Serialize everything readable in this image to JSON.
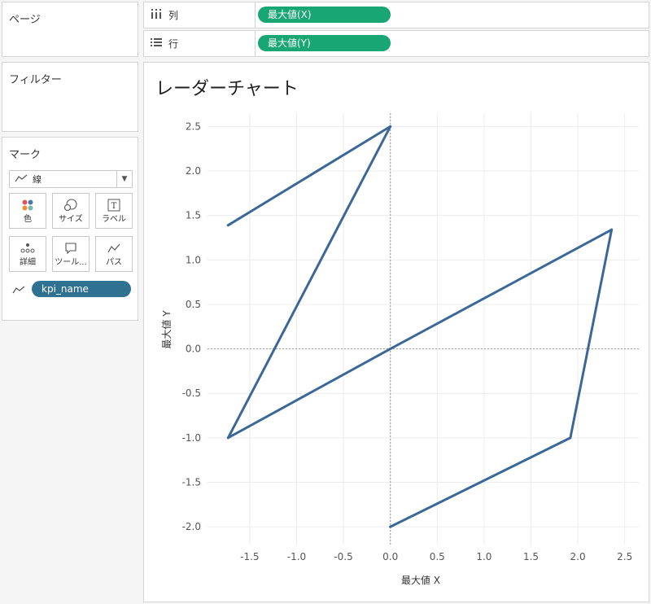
{
  "pages_panel": {
    "title": "ページ"
  },
  "filters_panel": {
    "title": "フィルター"
  },
  "marks_panel": {
    "title": "マーク",
    "mark_type": "線",
    "buttons": [
      "色",
      "サイズ",
      "ラベル",
      "詳細",
      "ツール...",
      "パス"
    ],
    "field_pill": "kpi_name"
  },
  "columns_shelf": {
    "label": "列",
    "pill": "最大値(X)"
  },
  "rows_shelf": {
    "label": "行",
    "pill": "最大値(Y)"
  },
  "colors": {
    "line": "#3b6896",
    "pill_green": "#17a674",
    "pill_blue": "#2e7191"
  },
  "chart_data": {
    "type": "line",
    "title": "レーダーチャート",
    "xlabel": "最大値 X",
    "ylabel": "最大値 Y",
    "xlim": [
      -1.95,
      2.65
    ],
    "ylim": [
      -2.2,
      2.65
    ],
    "x_ticks": [
      "-1.5",
      "-1.0",
      "-0.5",
      "0.0",
      "0.5",
      "1.0",
      "1.5",
      "2.0",
      "2.5"
    ],
    "y_ticks": [
      "-2.0",
      "-1.5",
      "-1.0",
      "-0.5",
      "0.0",
      "0.5",
      "1.0",
      "1.5",
      "2.0",
      "2.5"
    ],
    "grid": true,
    "zero_lines": true,
    "series": [
      {
        "x": [
          -1.73,
          0.0,
          -1.73,
          0.0,
          2.36,
          1.92,
          0.0
        ],
        "y": [
          1.39,
          2.5,
          -1.0,
          0.0,
          1.34,
          -1.0,
          -2.0
        ]
      }
    ]
  }
}
